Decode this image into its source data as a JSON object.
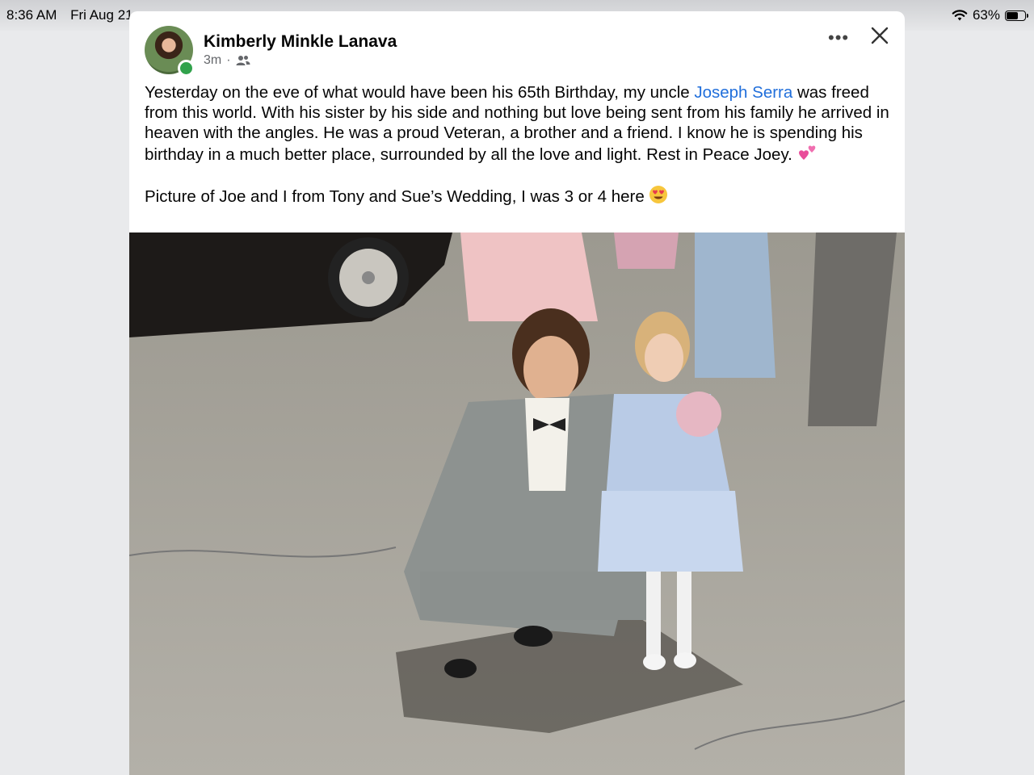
{
  "status_bar": {
    "time": "8:36 AM",
    "date": "Fri Aug 21",
    "battery": "63%",
    "battery_level": 0.63
  },
  "post": {
    "author": "Kimberly Minkle Lanava",
    "time": "3m",
    "separator": "·",
    "audience_icon": "friends-icon",
    "text_part1": "Yesterday on the eve of what would have been his 65th Birthday, my uncle ",
    "tagged_name": "Joseph Serra",
    "text_part2": " was freed from this world. With his sister by his side and nothing but love being sent from his family he arrived in heaven with the angles. He was a proud Veteran, a brother and a friend. I know he is spending his birthday in a much better place, surrounded by all the love and light. Rest in Peace Joey. ",
    "caption": "Picture of Joe and I from Tony and Sue’s Wedding, I was 3 or 4 here ",
    "colors": {
      "link": "#216fdb",
      "online": "#31a24c",
      "meta": "#65676b"
    }
  }
}
